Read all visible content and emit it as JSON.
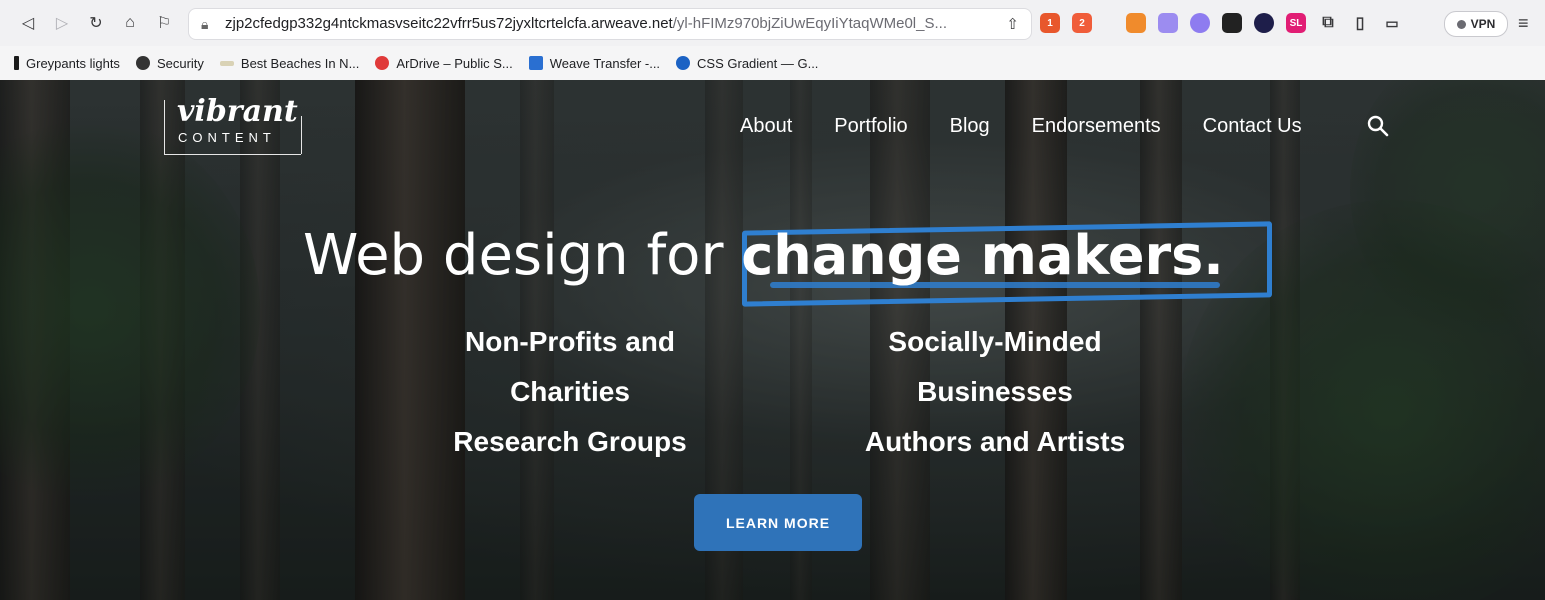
{
  "browser": {
    "url_main": "zjp2cfedgp332g4ntckmasvseitc22vfrr5us72jyxltcrtelcfa.arweave.net",
    "url_path": "/yl-hFIMz970bjZiUwEqyIiYtaqWMe0l_S...",
    "vpn_label": "VPN",
    "extension_badges": [
      "1",
      "2"
    ],
    "ext_sl_label": "SL"
  },
  "bookmarks": [
    {
      "label": "Greypants lights",
      "icon": "bookmark-bar-icon",
      "color": "#1b1b1b"
    },
    {
      "label": "Security",
      "icon": "globe-icon",
      "color": "#333333"
    },
    {
      "label": "Best Beaches In N...",
      "icon": "beach-icon",
      "color": "#d9d2b5"
    },
    {
      "label": "ArDrive – Public S...",
      "icon": "ardrive-icon",
      "color": "#e03a3a"
    },
    {
      "label": "Weave Transfer -...",
      "icon": "weave-icon",
      "color": "#2a6fd1"
    },
    {
      "label": "CSS Gradient — G...",
      "icon": "gradient-icon",
      "color": "#1b62c4"
    }
  ],
  "site": {
    "logo_script": "vibrant",
    "logo_sub": "CONTENT",
    "nav": [
      "About",
      "Portfolio",
      "Blog",
      "Endorsements",
      "Contact Us"
    ],
    "headline_light": "Web design for ",
    "headline_bold": "change makers.",
    "left_col": [
      "Non-Profits and",
      "Charities",
      "Research Groups"
    ],
    "right_col": [
      "Socially-Minded",
      "Businesses",
      "Authors and Artists"
    ],
    "cta": "LEARN MORE"
  },
  "colors": {
    "accent": "#2f7fd0",
    "button": "#2f73b9"
  }
}
